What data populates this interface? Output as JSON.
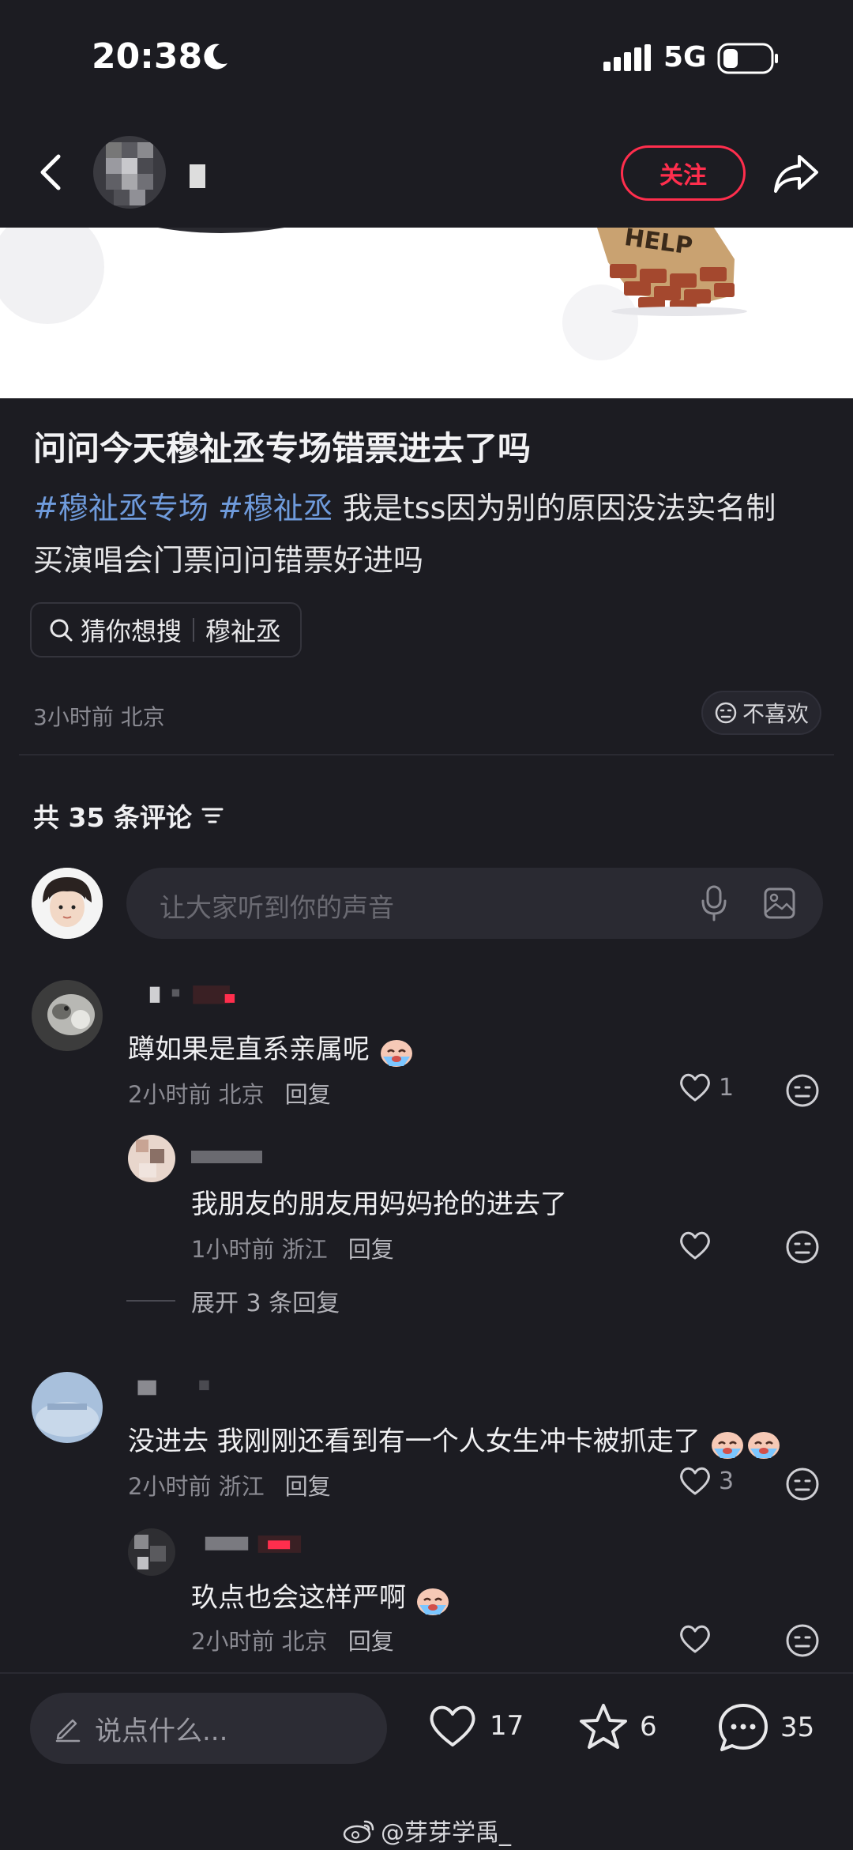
{
  "status_bar": {
    "time": "20:38",
    "network": "5G"
  },
  "nav": {
    "follow_label": "关注"
  },
  "post": {
    "title": "问问今天穆祉丞专场错票进去了吗",
    "tags": [
      "#穆祉丞专场",
      "#穆祉丞"
    ],
    "body_line1_rest": "我是tss因为别的原因没法实名制",
    "body_line2": "买演唱会门票问问错票好进吗",
    "guess_label": "猜你想搜",
    "guess_keyword": "穆祉丞",
    "meta": "3小时前 北京",
    "dislike_label": "不喜欢"
  },
  "comments_header": {
    "label": "共 35 条评论"
  },
  "comment_input": {
    "placeholder": "让大家听到你的声音"
  },
  "comments": [
    {
      "text": "蹲如果是直系亲属呢",
      "time": "2小时前",
      "location": "北京",
      "reply_label": "回复",
      "likes": "1",
      "replies": [
        {
          "text": "我朋友的朋友用妈妈抢的进去了",
          "time": "1小时前",
          "location": "浙江",
          "reply_label": "回复"
        }
      ],
      "expand_label": "展开 3 条回复"
    },
    {
      "text": "没进去 我刚刚还看到有一个人女生冲卡被抓走了",
      "time": "2小时前",
      "location": "浙江",
      "reply_label": "回复",
      "likes": "3",
      "replies": [
        {
          "text": "玖点也会这样严啊",
          "time": "2小时前",
          "location": "北京",
          "reply_label": "回复"
        }
      ]
    }
  ],
  "bottom_bar": {
    "say_placeholder": "说点什么...",
    "likes": "17",
    "stars": "6",
    "comments": "35"
  },
  "watermark": "@芽芽学禹_",
  "colors": {
    "accent": "#ff2e4d",
    "tag": "#6f9bdc",
    "background": "#1c1c22"
  }
}
